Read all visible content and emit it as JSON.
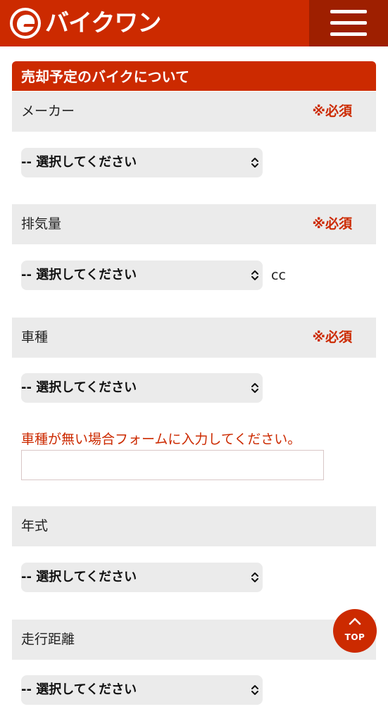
{
  "header": {
    "brand": "バイクワン"
  },
  "section_title": "売却予定のバイクについて",
  "required_label": "※必須",
  "select_placeholder": "-- 選択してください",
  "fields": {
    "maker": {
      "label": "メーカー"
    },
    "displacement": {
      "label": "排気量",
      "unit": "cc"
    },
    "model": {
      "label": "車種"
    },
    "year": {
      "label": "年式"
    },
    "mileage": {
      "label": "走行距離"
    }
  },
  "model_note": "車種が無い場合フォームに入力してください。",
  "model_input": {
    "value": "",
    "placeholder": ""
  },
  "top_button": {
    "label": "TOP"
  }
}
